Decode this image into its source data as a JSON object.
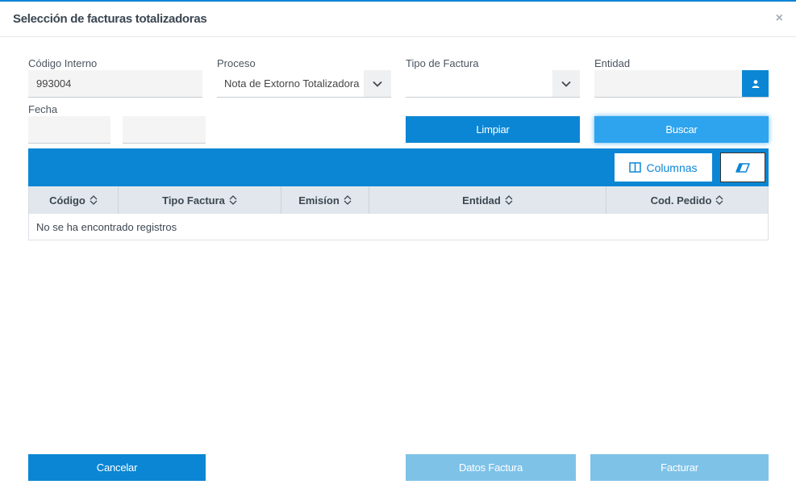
{
  "dialog": {
    "title": "Selección de facturas totalizadoras",
    "close_label": "×"
  },
  "form": {
    "codigo_interno": {
      "label": "Código Interno",
      "value": "993004"
    },
    "proceso": {
      "label": "Proceso",
      "value": "Nota de Extorno Totalizadora"
    },
    "tipo_factura": {
      "label": "Tipo de Factura",
      "value": ""
    },
    "entidad": {
      "label": "Entidad",
      "value": ""
    },
    "fecha": {
      "label": "Fecha",
      "desde": "",
      "hasta": ""
    }
  },
  "buttons": {
    "limpiar": "Limpiar",
    "buscar": "Buscar",
    "cancelar": "Cancelar",
    "datos_factura": "Datos Factura",
    "facturar": "Facturar"
  },
  "table": {
    "columns_button": "Columnas",
    "headers": [
      "Código",
      "Tipo Factura",
      "Emisíon",
      "Entidad",
      "Cod. Pedido"
    ],
    "empty_message": "No se ha encontrado registros"
  },
  "icons": {
    "close": "close-icon",
    "dropdown": "chevron-down-icon",
    "user": "user-icon",
    "columns": "columns-icon",
    "eraser": "eraser-icon",
    "sort": "sort-icon"
  },
  "colors": {
    "primary": "#0b86d4",
    "primary_hover": "#2ea3ee",
    "disabled": "#7ec2e8",
    "header_bg": "#e1e7ec"
  }
}
